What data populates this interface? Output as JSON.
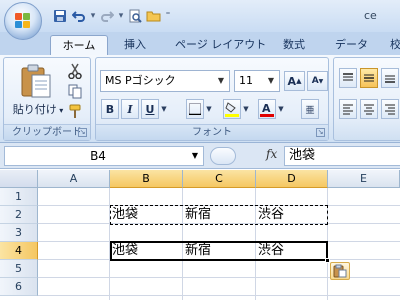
{
  "window": {
    "title": "ce"
  },
  "tabs": [
    {
      "label": "ホーム",
      "active": true
    },
    {
      "label": "挿入"
    },
    {
      "label": "ページ レイアウト"
    },
    {
      "label": "数式"
    },
    {
      "label": "データ"
    },
    {
      "label": "校"
    }
  ],
  "ribbon": {
    "clipboard": {
      "label": "クリップボード",
      "paste_label": "貼り付け"
    },
    "font": {
      "label": "フォント",
      "font_name": "MS Pゴシック",
      "font_size": "11",
      "bold": "B",
      "italic": "I",
      "underline": "U"
    }
  },
  "formula_bar": {
    "name_box": "B4",
    "fx_label": "fx",
    "content": "池袋"
  },
  "columns": [
    "A",
    "B",
    "C",
    "D",
    "E"
  ],
  "selected_column_indices": [
    1,
    2,
    3
  ],
  "rows": [
    "1",
    "2",
    "3",
    "4",
    "5",
    "6"
  ],
  "selected_row": "4",
  "cells": {
    "row2": {
      "B": "池袋",
      "C": "新宿",
      "D": "渋谷"
    },
    "row4": {
      "B": "池袋",
      "C": "新宿",
      "D": "渋谷"
    }
  },
  "colors": {
    "selected_header": "#f5c762",
    "font_highlight": "#ffff00",
    "font_color": "#e00000",
    "ribbon_bg": "#dbe8f7"
  }
}
